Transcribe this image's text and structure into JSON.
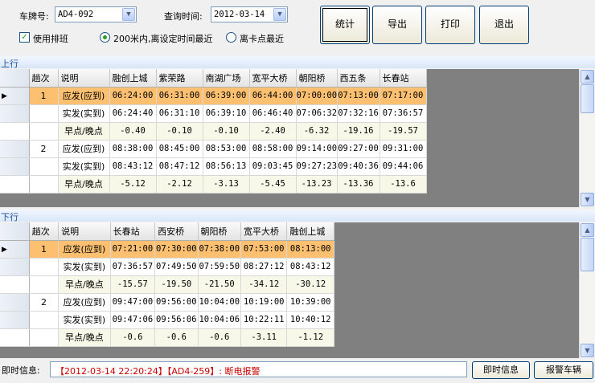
{
  "filters": {
    "plate_label": "车牌号:",
    "plate_value": "AD4-092",
    "date_label": "查询时间:",
    "date_value": "2012-03-14",
    "use_schedule_label": "使用排班",
    "use_schedule_checked": true,
    "radio_near_time_label": "200米内,离设定时间最近",
    "radio_near_stop_label": "离卡点最近",
    "radio_selected": "near_time"
  },
  "toolbar": {
    "stats_label": "统计",
    "export_label": "导出",
    "print_label": "打印",
    "exit_label": "退出"
  },
  "upward": {
    "section_label": "上行",
    "headers": [
      "趟次",
      "说明",
      "融创上城",
      "紫荣路",
      "南湖广场",
      "宽平大桥",
      "朝阳桥",
      "西五条",
      "长春站"
    ],
    "rows": [
      {
        "trip": "1",
        "desc": "应发(应到)",
        "values": [
          "06:24:00",
          "06:31:00",
          "06:39:00",
          "06:44:00",
          "07:00:00",
          "07:13:00",
          "07:17:00"
        ],
        "selected": true
      },
      {
        "trip": "",
        "desc": "实发(实到)",
        "values": [
          "06:24:40",
          "06:31:10",
          "06:39:10",
          "06:46:40",
          "07:06:32",
          "07:32:16",
          "07:36:57"
        ]
      },
      {
        "trip": "",
        "desc": "早点/晚点",
        "values": [
          "-0.40",
          "-0.10",
          "-0.10",
          "-2.40",
          "-6.32",
          "-19.16",
          "-19.57"
        ]
      },
      {
        "trip": "2",
        "desc": "应发(应到)",
        "values": [
          "08:38:00",
          "08:45:00",
          "08:53:00",
          "08:58:00",
          "09:14:00",
          "09:27:00",
          "09:31:00"
        ]
      },
      {
        "trip": "",
        "desc": "实发(实到)",
        "values": [
          "08:43:12",
          "08:47:12",
          "08:56:13",
          "09:03:45",
          "09:27:23",
          "09:40:36",
          "09:44:06"
        ]
      },
      {
        "trip": "",
        "desc": "早点/晚点",
        "values": [
          "-5.12",
          "-2.12",
          "-3.13",
          "-5.45",
          "-13.23",
          "-13.36",
          "-13.6"
        ]
      }
    ]
  },
  "downward": {
    "section_label": "下行",
    "headers": [
      "趟次",
      "说明",
      "长春站",
      "西安桥",
      "朝阳桥",
      "宽平大桥",
      "融创上城"
    ],
    "rows": [
      {
        "trip": "1",
        "desc": "应发(应到)",
        "values": [
          "07:21:00",
          "07:30:00",
          "07:38:00",
          "07:53:00",
          "08:13:00"
        ],
        "selected": true
      },
      {
        "trip": "",
        "desc": "实发(实到)",
        "values": [
          "07:36:57",
          "07:49:50",
          "07:59:50",
          "08:27:12",
          "08:43:12"
        ]
      },
      {
        "trip": "",
        "desc": "早点/晚点",
        "values": [
          "-15.57",
          "-19.50",
          "-21.50",
          "-34.12",
          "-30.12"
        ]
      },
      {
        "trip": "2",
        "desc": "应发(应到)",
        "values": [
          "09:47:00",
          "09:56:00",
          "10:04:00",
          "10:19:00",
          "10:39:00"
        ]
      },
      {
        "trip": "",
        "desc": "实发(实到)",
        "values": [
          "09:47:06",
          "09:56:06",
          "10:04:06",
          "10:22:11",
          "10:40:12"
        ]
      },
      {
        "trip": "",
        "desc": "早点/晚点",
        "values": [
          "-0.6",
          "-0.6",
          "-0.6",
          "-3.11",
          "-1.12"
        ]
      }
    ]
  },
  "statusbar": {
    "label": "即时信息:",
    "message": "【2012-03-14 22:20:24】【AD4-259】: 断电报警",
    "realtime_button": "即时信息",
    "alarm_button": "报警车辆"
  },
  "colors": {
    "selected_row": "#fcc070",
    "alt_row": "#f8f8e8",
    "section_text": "#1f4f9c",
    "alert_text": "#cc0000"
  }
}
